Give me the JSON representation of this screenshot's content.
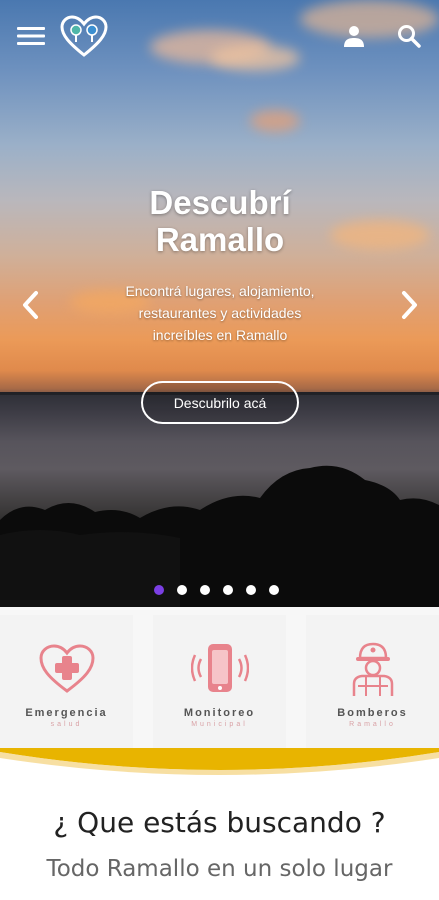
{
  "header": {
    "menu_icon": "hamburger-menu-icon",
    "logo_icon": "heart-pin-logo-icon",
    "user_icon": "user-icon",
    "search_icon": "search-icon"
  },
  "hero": {
    "title_line1": "Descubrí",
    "title_line2": "Ramallo",
    "subtitle_line1": "Encontrá lugares, alojamiento,",
    "subtitle_line2": "restaurantes y actividades",
    "subtitle_line3": "increíbles en Ramallo",
    "cta_label": "Descubrilo acá",
    "prev_icon": "chevron-left-icon",
    "next_icon": "chevron-right-icon",
    "slide_count": 6,
    "active_slide": 1
  },
  "quick_access": [
    {
      "label": "Emergencia",
      "sub": "salud",
      "icon": "heart-medical-cross-icon"
    },
    {
      "label": "Monitoreo",
      "sub": "Municipal",
      "icon": "phone-vibrating-icon"
    },
    {
      "label": "Bomberos",
      "sub": "Ramallo",
      "icon": "firefighter-icon"
    }
  ],
  "search_section": {
    "title": "¿ Que estás buscando ?",
    "subtitle": "Todo Ramallo en un solo lugar"
  },
  "colors": {
    "accent": "#7b3fe4",
    "quick_icon": "#e8838c",
    "wave_gold": "#e8b400"
  }
}
